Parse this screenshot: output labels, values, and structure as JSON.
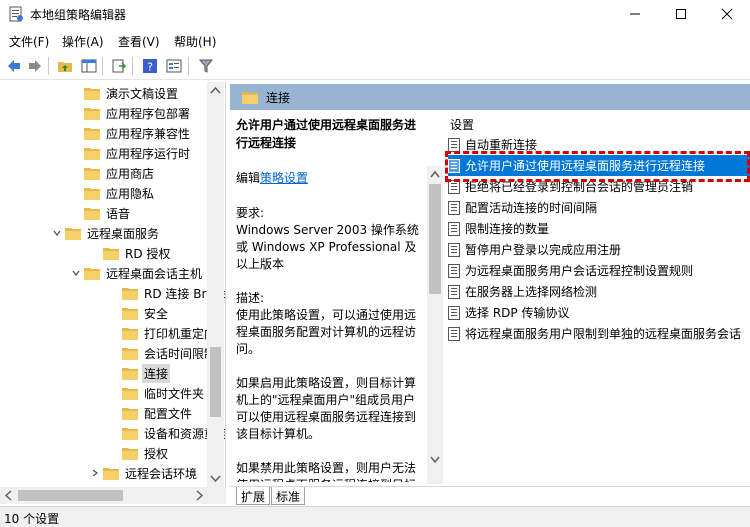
{
  "window": {
    "title": "本地组策略编辑器"
  },
  "menu": {
    "items": [
      "文件(F)",
      "操作(A)",
      "查看(V)",
      "帮助(H)"
    ]
  },
  "tree": {
    "items": [
      {
        "label": "演示文稿设置",
        "indent": 4,
        "expander": ""
      },
      {
        "label": "应用程序包部署",
        "indent": 4,
        "expander": ""
      },
      {
        "label": "应用程序兼容性",
        "indent": 4,
        "expander": ""
      },
      {
        "label": "应用程序运行时",
        "indent": 4,
        "expander": ""
      },
      {
        "label": "应用商店",
        "indent": 4,
        "expander": ""
      },
      {
        "label": "应用隐私",
        "indent": 4,
        "expander": ""
      },
      {
        "label": "语音",
        "indent": 4,
        "expander": ""
      },
      {
        "label": "远程桌面服务",
        "indent": 3,
        "expander": "expanded"
      },
      {
        "label": "RD 授权",
        "indent": 5,
        "expander": ""
      },
      {
        "label": "远程桌面会话主机",
        "indent": 4,
        "expander": "expanded"
      },
      {
        "label": "RD 连接 Broker",
        "indent": 6,
        "expander": ""
      },
      {
        "label": "安全",
        "indent": 6,
        "expander": ""
      },
      {
        "label": "打印机重定向",
        "indent": 6,
        "expander": ""
      },
      {
        "label": "会话时间限制",
        "indent": 6,
        "expander": ""
      },
      {
        "label": "连接",
        "indent": 6,
        "expander": "",
        "selected": true
      },
      {
        "label": "临时文件夹",
        "indent": 6,
        "expander": ""
      },
      {
        "label": "配置文件",
        "indent": 6,
        "expander": ""
      },
      {
        "label": "设备和资源重定向",
        "indent": 6,
        "expander": ""
      },
      {
        "label": "授权",
        "indent": 6,
        "expander": ""
      },
      {
        "label": "远程会话环境",
        "indent": 5,
        "expander": "collapsed"
      }
    ]
  },
  "content": {
    "header": "连接",
    "desc": {
      "title": "允许用户通过使用远程桌面服务进行远程连接",
      "edit_prefix": "编辑",
      "edit_link": "策略设置",
      "req_label": "要求:",
      "req_text": "Windows Server 2003 操作系统或 Windows XP Professional 及以上版本",
      "desc_label": "描述:",
      "desc_text": "使用此策略设置，可以通过使用远程桌面服务配置对计算机的远程访问。",
      "enabled_text": "如果启用此策略设置，则目标计算机上的\"远程桌面用户\"组成员用户可以使用远程桌面服务远程连接到该目标计算机。",
      "disabled_text": "如果禁用此策略设置，则用户无法使用远程桌面服务远程连接到目标计算机。"
    },
    "settings_header": "设置",
    "settings": [
      {
        "label": "自动重新连接",
        "selected": false
      },
      {
        "label": "允许用户通过使用远程桌面服务进行远程连接",
        "selected": true
      },
      {
        "label": "拒绝将已经登录到控制台会话的管理员注销",
        "selected": false
      },
      {
        "label": "配置活动连接的时间间隔",
        "selected": false
      },
      {
        "label": "限制连接的数量",
        "selected": false
      },
      {
        "label": "暂停用户登录以完成应用注册",
        "selected": false
      },
      {
        "label": "为远程桌面服务用户会话远程控制设置规则",
        "selected": false
      },
      {
        "label": "在服务器上选择网络检测",
        "selected": false
      },
      {
        "label": "选择 RDP 传输协议",
        "selected": false
      },
      {
        "label": "将远程桌面服务用户限制到单独的远程桌面服务会话",
        "selected": false
      }
    ]
  },
  "tabs": [
    "扩展",
    "标准"
  ],
  "status": {
    "text": "10 个设置"
  },
  "colors": {
    "accent": "#0078d7",
    "header_bg": "#99b4d1",
    "highlight": "#d40000",
    "folder": "#e8b84a"
  }
}
